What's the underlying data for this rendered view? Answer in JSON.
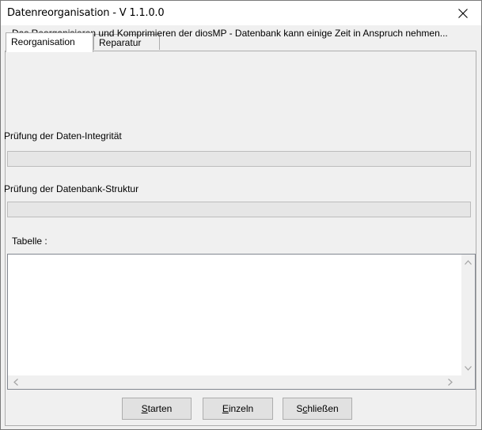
{
  "window": {
    "title": "Datenreorganisation - V 1.1.0.0"
  },
  "tabs": [
    {
      "label": "Reorganisation",
      "active": true
    },
    {
      "label": "Reparatur",
      "active": false
    }
  ],
  "main": {
    "info_text": "Das Reorganisieren und Komprimieren der diosMP - Datenbank kann einige Zeit in Anspruch nehmen...",
    "integrity_label": "Prüfung der Daten-Integrität",
    "integrity_progress": 0,
    "structure_label": "Prüfung der Datenbank-Struktur",
    "structure_progress": 0,
    "table_label": "Tabelle :",
    "table_items": []
  },
  "buttons": {
    "start": {
      "pre": "",
      "mnemonic": "S",
      "post": "tarten"
    },
    "single": {
      "pre": "",
      "mnemonic": "E",
      "post": "inzeln"
    },
    "close": {
      "pre": "S",
      "mnemonic": "c",
      "post": "hließen"
    }
  },
  "colors": {
    "progress_fill": "#06b025",
    "window_bg": "#f0f0f0",
    "button_bg": "#e1e1e1"
  },
  "icons": {
    "close": "close-icon",
    "scroll_up": "scroll-up-arrow-icon",
    "scroll_down": "scroll-down-arrow-icon",
    "scroll_left": "scroll-left-arrow-icon",
    "scroll_right": "scroll-right-arrow-icon"
  }
}
